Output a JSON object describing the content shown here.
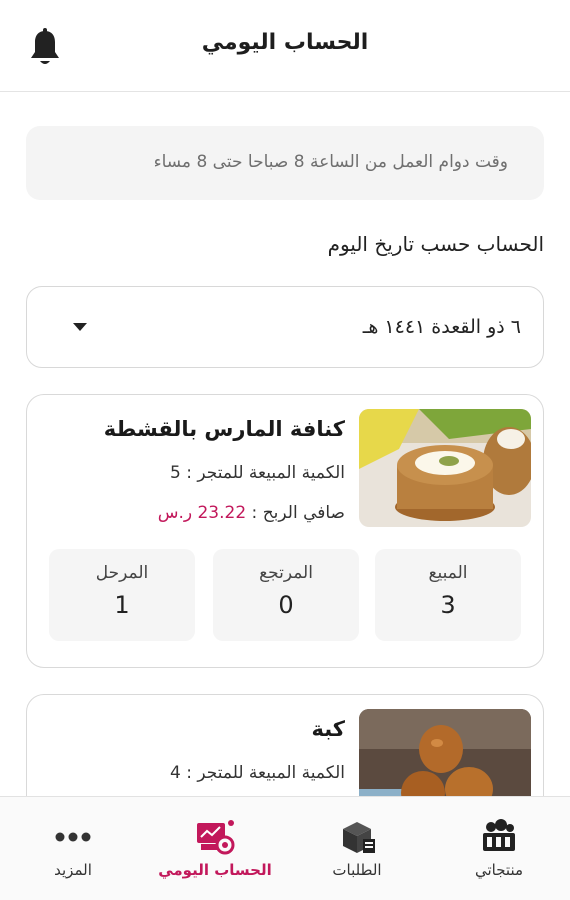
{
  "header": {
    "title": "الحساب اليومي"
  },
  "notice": {
    "text": "وقت دوام العمل من الساعة 8 صباحا حتى 8 مساء"
  },
  "section": {
    "label": "الحساب حسب تاريخ اليوم"
  },
  "date_select": {
    "value": "٦ ذو القعدة ١٤٤١ هـ"
  },
  "products": [
    {
      "name": "كنافة المارس بالقشطة",
      "qty_label": "الكمية المبيعة للمتجر : 5",
      "profit_label": "صافي الربح : ",
      "profit_value": "23.22 ر.س",
      "stats": [
        {
          "label": "المبيع",
          "value": "3"
        },
        {
          "label": "المرتجع",
          "value": "0"
        },
        {
          "label": "المرحل",
          "value": "1"
        }
      ]
    },
    {
      "name": "كبة",
      "qty_label": "الكمية المبيعة للمتجر : 4"
    }
  ],
  "bottom_nav": [
    {
      "label": "منتجاتي",
      "icon": "products-icon",
      "active": false
    },
    {
      "label": "الطلبات",
      "icon": "orders-box-icon",
      "active": false
    },
    {
      "label": "الحساب اليومي",
      "icon": "daily-account-icon",
      "active": true
    },
    {
      "label": "المزيد",
      "icon": "more-dots-icon",
      "active": false
    }
  ],
  "colors": {
    "accent": "#c2185b",
    "text": "#222222",
    "muted_bg": "#f4f4f4"
  }
}
